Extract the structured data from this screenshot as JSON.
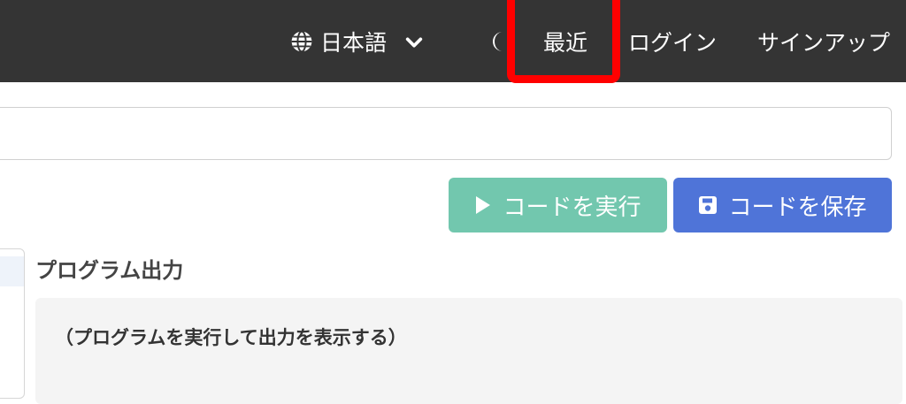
{
  "navbar": {
    "language_label": "日本語",
    "recent_label": "最近",
    "login_label": "ログイン",
    "signup_label": "サインアップ",
    "background_color": "#343434",
    "icons": {
      "language": "globe-icon",
      "language_toggle": "chevron-down-icon",
      "theme": "moon-icon"
    }
  },
  "highlight": {
    "target": "最近",
    "color": "#ff0000"
  },
  "code_input": {
    "value": ""
  },
  "actions": {
    "run_label": "コードを実行",
    "run_icon": "play-icon",
    "run_color": "#72c7ae",
    "save_label": "コードを保存",
    "save_icon": "save-icon",
    "save_color": "#4f74d8"
  },
  "output": {
    "heading": "プログラム出力",
    "placeholder": "（プログラムを実行して出力を表示する）"
  }
}
